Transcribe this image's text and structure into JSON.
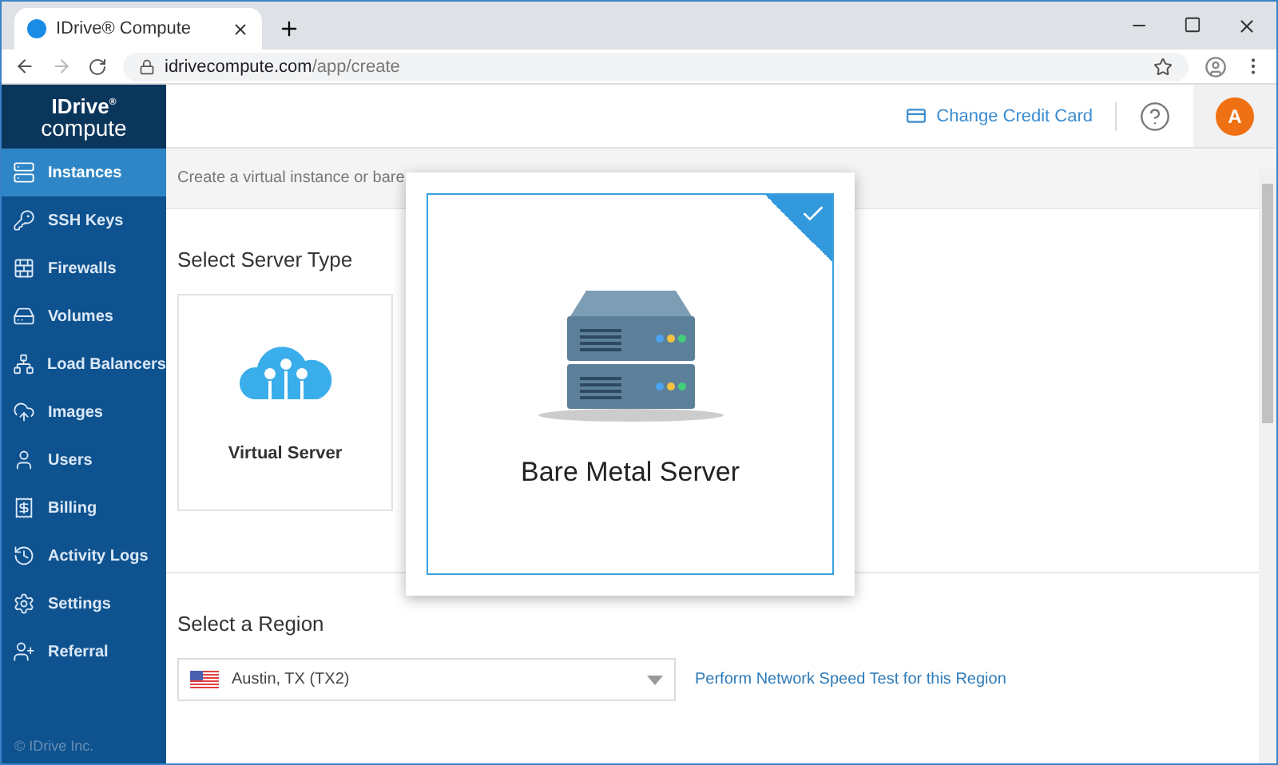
{
  "browser": {
    "tab_title": "IDrive® Compute",
    "url_host": "idrivecompute.com",
    "url_path": "/app/create"
  },
  "logo": {
    "brand": "IDrive",
    "mark": "®",
    "product": "compute"
  },
  "sidebar": {
    "items": [
      {
        "label": "Instances",
        "kind": "server",
        "selected": true
      },
      {
        "label": "SSH Keys",
        "kind": "key",
        "selected": false
      },
      {
        "label": "Firewalls",
        "kind": "firewall",
        "selected": false
      },
      {
        "label": "Volumes",
        "kind": "drive",
        "selected": false
      },
      {
        "label": "Load Balancers",
        "kind": "network",
        "selected": false
      },
      {
        "label": "Images",
        "kind": "cloud",
        "selected": false
      },
      {
        "label": "Users",
        "kind": "user",
        "selected": false
      },
      {
        "label": "Billing",
        "kind": "billing",
        "selected": false
      },
      {
        "label": "Activity Logs",
        "kind": "history",
        "selected": false
      },
      {
        "label": "Settings",
        "kind": "settings",
        "selected": false
      },
      {
        "label": "Referral",
        "kind": "referral",
        "selected": false
      }
    ],
    "footer": "© IDrive Inc."
  },
  "header": {
    "link": "Change Credit Card",
    "avatar": "A"
  },
  "intro": "Create a virtual instance or bare",
  "server_type": {
    "title": "Select Server Type",
    "options": [
      {
        "label": "Virtual Server",
        "kind": "virtual",
        "selected": false
      },
      {
        "label": "Bare Metal Server",
        "kind": "metal",
        "selected": true
      }
    ]
  },
  "region": {
    "title": "Select a Region",
    "value": "Austin, TX (TX2)",
    "link": "Perform Network Speed Test for this Region"
  }
}
